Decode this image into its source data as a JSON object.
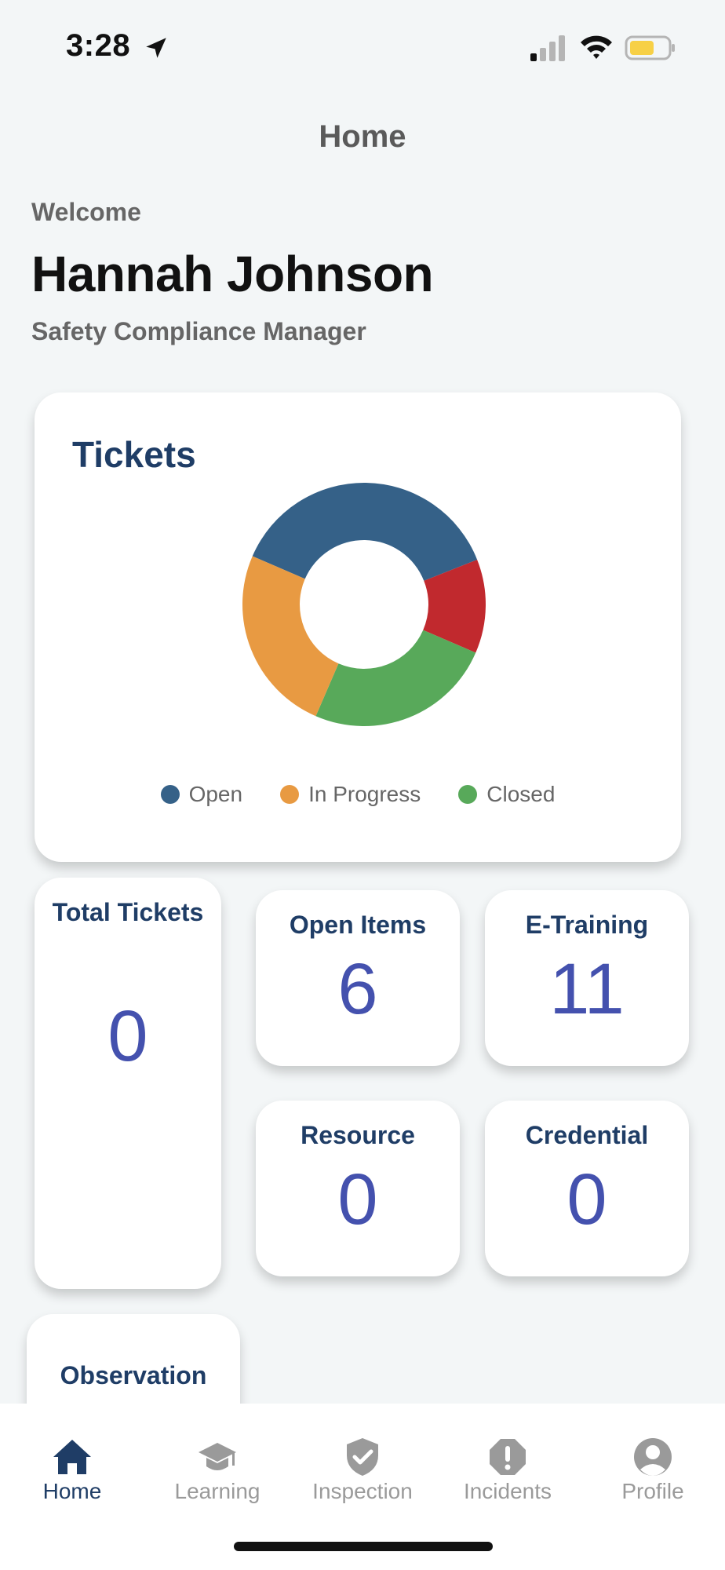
{
  "status_bar": {
    "time": "3:28"
  },
  "header": {
    "title": "Home"
  },
  "user": {
    "greeting": "Welcome",
    "name": "Hannah Johnson",
    "role": "Safety Compliance Manager"
  },
  "tickets_card": {
    "title": "Tickets",
    "legend": [
      {
        "label": "Open",
        "color": "#356188"
      },
      {
        "label": "In Progress",
        "color": "#e89a42"
      },
      {
        "label": "Closed",
        "color": "#58a95a"
      }
    ]
  },
  "chart_data": {
    "type": "pie",
    "slices": [
      {
        "label": "Open",
        "value": 0.375,
        "color": "#356188"
      },
      {
        "label": "",
        "value": 0.125,
        "color": "#c1292e"
      },
      {
        "label": "Closed",
        "value": 0.25,
        "color": "#58a95a"
      },
      {
        "label": "In Progress",
        "value": 0.25,
        "color": "#e89a42"
      }
    ],
    "title": "Tickets",
    "legend": [
      "Open",
      "In Progress",
      "Closed"
    ],
    "legend_position": "bottom",
    "donut": true
  },
  "stats": {
    "total_tickets": {
      "label": "Total Tickets",
      "value": "0"
    },
    "open_items": {
      "label": "Open Items",
      "value": "6"
    },
    "e_training": {
      "label": "E-Training",
      "value": "11"
    },
    "resource": {
      "label": "Resource",
      "value": "0"
    },
    "credential": {
      "label": "Credential",
      "value": "0"
    },
    "observation": {
      "label": "Observation"
    }
  },
  "nav": {
    "items": [
      {
        "label": "Home",
        "icon": "home-icon",
        "active": true
      },
      {
        "label": "Learning",
        "icon": "graduation-cap-icon",
        "active": false
      },
      {
        "label": "Inspection",
        "icon": "shield-check-icon",
        "active": false
      },
      {
        "label": "Incidents",
        "icon": "alert-icon",
        "active": false
      },
      {
        "label": "Profile",
        "icon": "person-icon",
        "active": false
      }
    ]
  },
  "colors": {
    "accent": "#1f3d66",
    "value": "#4451ae",
    "inactive": "#9a9a9a",
    "battery": "#f7d046"
  }
}
